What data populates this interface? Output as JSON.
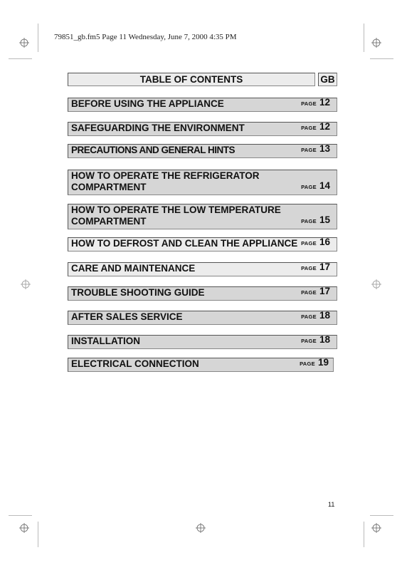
{
  "header": {
    "file_info": "79851_gb.fm5  Page 11  Wednesday, June 7, 2000  4:35 PM"
  },
  "toc": {
    "title": "TABLE OF CONTENTS",
    "language": "GB",
    "page_word": "PAGE",
    "entries": [
      {
        "label": "BEFORE USING THE APPLIANCE",
        "page": "12"
      },
      {
        "label": "SAFEGUARDING THE ENVIRONMENT",
        "page": "12"
      },
      {
        "label": "PRECAUTIONS AND GENERAL HINTS",
        "page": "13"
      },
      {
        "label": "HOW TO OPERATE THE REFRIGERATOR\nCOMPARTMENT",
        "page": "14"
      },
      {
        "label": "HOW TO OPERATE THE LOW TEMPERATURE\nCOMPARTMENT",
        "page": "15"
      },
      {
        "label": "HOW TO DEFROST AND CLEAN THE APPLIANCE",
        "page": "16"
      },
      {
        "label": "CARE AND MAINTENANCE",
        "page": "17"
      },
      {
        "label": "TROUBLE SHOOTING GUIDE",
        "page": "17"
      },
      {
        "label": "AFTER SALES SERVICE",
        "page": "18"
      },
      {
        "label": "INSTALLATION",
        "page": "18"
      },
      {
        "label": "ELECTRICAL CONNECTION",
        "page": "19"
      }
    ]
  },
  "footer": {
    "page_number": "11"
  }
}
